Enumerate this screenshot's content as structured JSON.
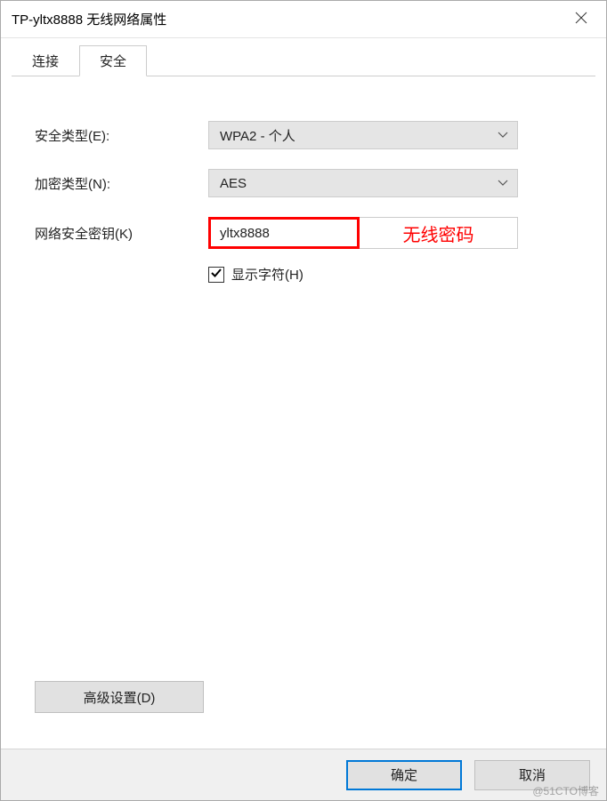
{
  "window": {
    "title": "TP-yltx8888 无线网络属性"
  },
  "tabs": {
    "connect": "连接",
    "security": "安全"
  },
  "form": {
    "security_type_label": "安全类型(E):",
    "security_type_value": "WPA2 - 个人",
    "encryption_type_label": "加密类型(N):",
    "encryption_type_value": "AES",
    "network_key_label": "网络安全密钥(K)",
    "network_key_value": "yltx8888",
    "annotation": "无线密码",
    "show_chars_label": "显示字符(H)",
    "show_chars_checked": true
  },
  "buttons": {
    "advanced": "高级设置(D)",
    "ok": "确定",
    "cancel": "取消"
  },
  "watermark": "@51CTO博客"
}
